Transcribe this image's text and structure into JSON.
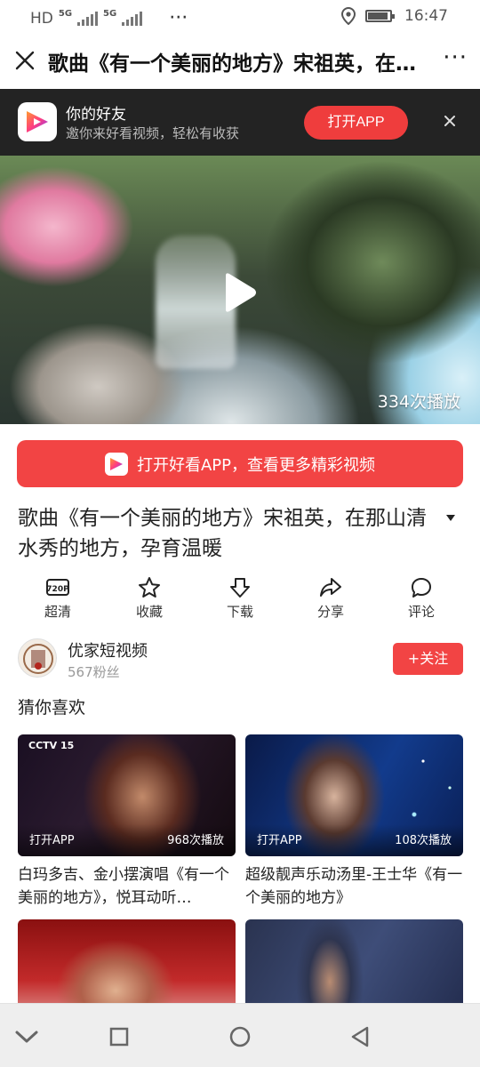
{
  "status_bar": {
    "carrier": "HD",
    "net1": "5G",
    "net2": "5G",
    "dots": "···",
    "time": "16:47"
  },
  "header": {
    "title": "歌曲《有一个美丽的地方》宋祖英，在那...",
    "more": "···"
  },
  "friend_banner": {
    "title": "你的好友",
    "subtitle": "邀你来好看视频，轻松有收获",
    "open_button": "打开APP"
  },
  "video": {
    "play_count": "334次播放"
  },
  "open_app_button": "打开好看APP，查看更多精彩视频",
  "video_title": "歌曲《有一个美丽的地方》宋祖英，在那山清水秀的地方，孕育温暖",
  "actions": [
    {
      "label": "超清",
      "icon": "720p-icon",
      "badge": "720P"
    },
    {
      "label": "收藏",
      "icon": "star-icon"
    },
    {
      "label": "下载",
      "icon": "download-icon"
    },
    {
      "label": "分享",
      "icon": "share-icon"
    },
    {
      "label": "评论",
      "icon": "comment-icon"
    }
  ],
  "author": {
    "name": "优家短视频",
    "fans": "567粉丝",
    "follow": "+关注"
  },
  "guess_heading": "猜你喜欢",
  "recommendations": [
    {
      "title": "白玛多吉、金小摆演唱《有一个美丽的地方》，悦耳动听…",
      "open_label": "打开APP",
      "plays": "968次播放"
    },
    {
      "title": "超级靓声乐动汤里-王士华《有一个美丽的地方》",
      "open_label": "打开APP",
      "plays": "108次播放"
    }
  ],
  "colors": {
    "accent": "#f24444",
    "banner_bg": "#232323"
  }
}
